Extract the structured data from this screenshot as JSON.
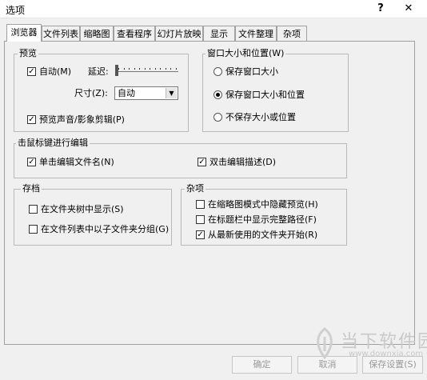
{
  "window": {
    "title": "选项",
    "help": "?",
    "close": "✕"
  },
  "tabs": [
    {
      "label": "浏览器",
      "active": true
    },
    {
      "label": "文件列表"
    },
    {
      "label": "缩略图"
    },
    {
      "label": "查看程序"
    },
    {
      "label": "幻灯片放映"
    },
    {
      "label": "显示"
    },
    {
      "label": "文件整理"
    },
    {
      "label": "杂项"
    }
  ],
  "preview": {
    "title": "预览",
    "auto": {
      "label": "自动(M)",
      "checked": true
    },
    "delay_label": "延迟:",
    "size_label": "尺寸(Z):",
    "size_value": "自动",
    "audio": {
      "label": "预览声音/影象剪辑(P)",
      "checked": true
    }
  },
  "window_size": {
    "title": "窗口大小和位置(W)",
    "options": [
      {
        "label": "保存窗口大小",
        "selected": false
      },
      {
        "label": "保存窗口大小和位置",
        "selected": true
      },
      {
        "label": "不保存大小或位置",
        "selected": false
      }
    ]
  },
  "edit": {
    "title": "击鼠标键进行编辑",
    "single": {
      "label": "单击编辑文件名(N)",
      "checked": true
    },
    "double": {
      "label": "双击编辑描述(D)",
      "checked": true
    }
  },
  "archive": {
    "title": "存档",
    "items": [
      {
        "label": "在文件夹树中显示(S)",
        "checked": false
      },
      {
        "label": "在文件列表中以子文件夹分组(G)",
        "checked": false
      }
    ]
  },
  "misc": {
    "title": "杂项",
    "items": [
      {
        "label": "在缩略图模式中隐藏预览(H)",
        "checked": false
      },
      {
        "label": "在标题栏中显示完整路径(F)",
        "checked": false
      },
      {
        "label": "从最新使用的文件夹开始(R)",
        "checked": true
      }
    ]
  },
  "buttons": {
    "ok": "确定",
    "cancel": "取消",
    "save": "保存设置(S)"
  },
  "watermark": {
    "text": "当下软件园",
    "url": "www.downxia.com"
  },
  "check_glyph": "✓",
  "colors": {
    "accent": "#000000"
  }
}
